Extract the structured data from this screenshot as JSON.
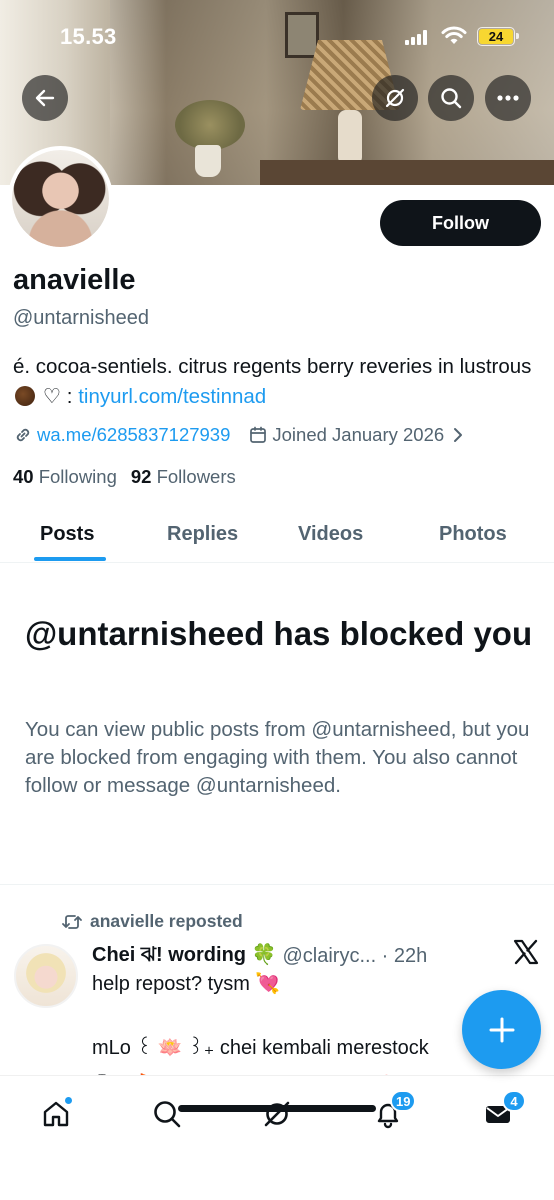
{
  "status_bar": {
    "time": "15.53",
    "battery": "24"
  },
  "profile": {
    "display_name": "anavielle",
    "handle": "@untarnisheed",
    "bio_text": "é. cocoa-sentiels. citrus regents berry reveries in lustrous",
    "bio_suffix": "♡ :",
    "bio_link": "tinyurl.com/testinnad",
    "website": "wa.me/6285837127939",
    "joined": "Joined January 2026",
    "following_count": "40",
    "following_label": "Following",
    "followers_count": "92",
    "followers_label": "Followers",
    "follow_button": "Follow"
  },
  "tabs": [
    "Posts",
    "Replies",
    "Videos",
    "Photos"
  ],
  "blocked": {
    "title": "@untarnisheed has blocked you",
    "body": "You can view public posts from @untarnisheed, but you are blocked from engaging with them. You also cannot follow or message @untarnisheed."
  },
  "post": {
    "repost_label": "anavielle reposted",
    "author_name": "Chei ঝ! wording 🍀",
    "author_handle": "@clairyc... · 22h",
    "line1": "help repost? tysm",
    "line1_emoji": "💘",
    "line2": "mLo ꒰ 🪷 ꒱₊ chei kembali merestock",
    "line3": "ⓘ : 🎪 ₊₊ ada wording pinned 🎀 ✎ ⋆"
  },
  "nav": {
    "notifications_badge": "19",
    "messages_badge": "4",
    "icons": [
      "home-icon",
      "search-icon",
      "grok-icon",
      "bell-icon",
      "mail-icon"
    ]
  },
  "colors": {
    "accent": "#1d9bf0",
    "text": "#0f1419",
    "secondary": "#536471"
  }
}
